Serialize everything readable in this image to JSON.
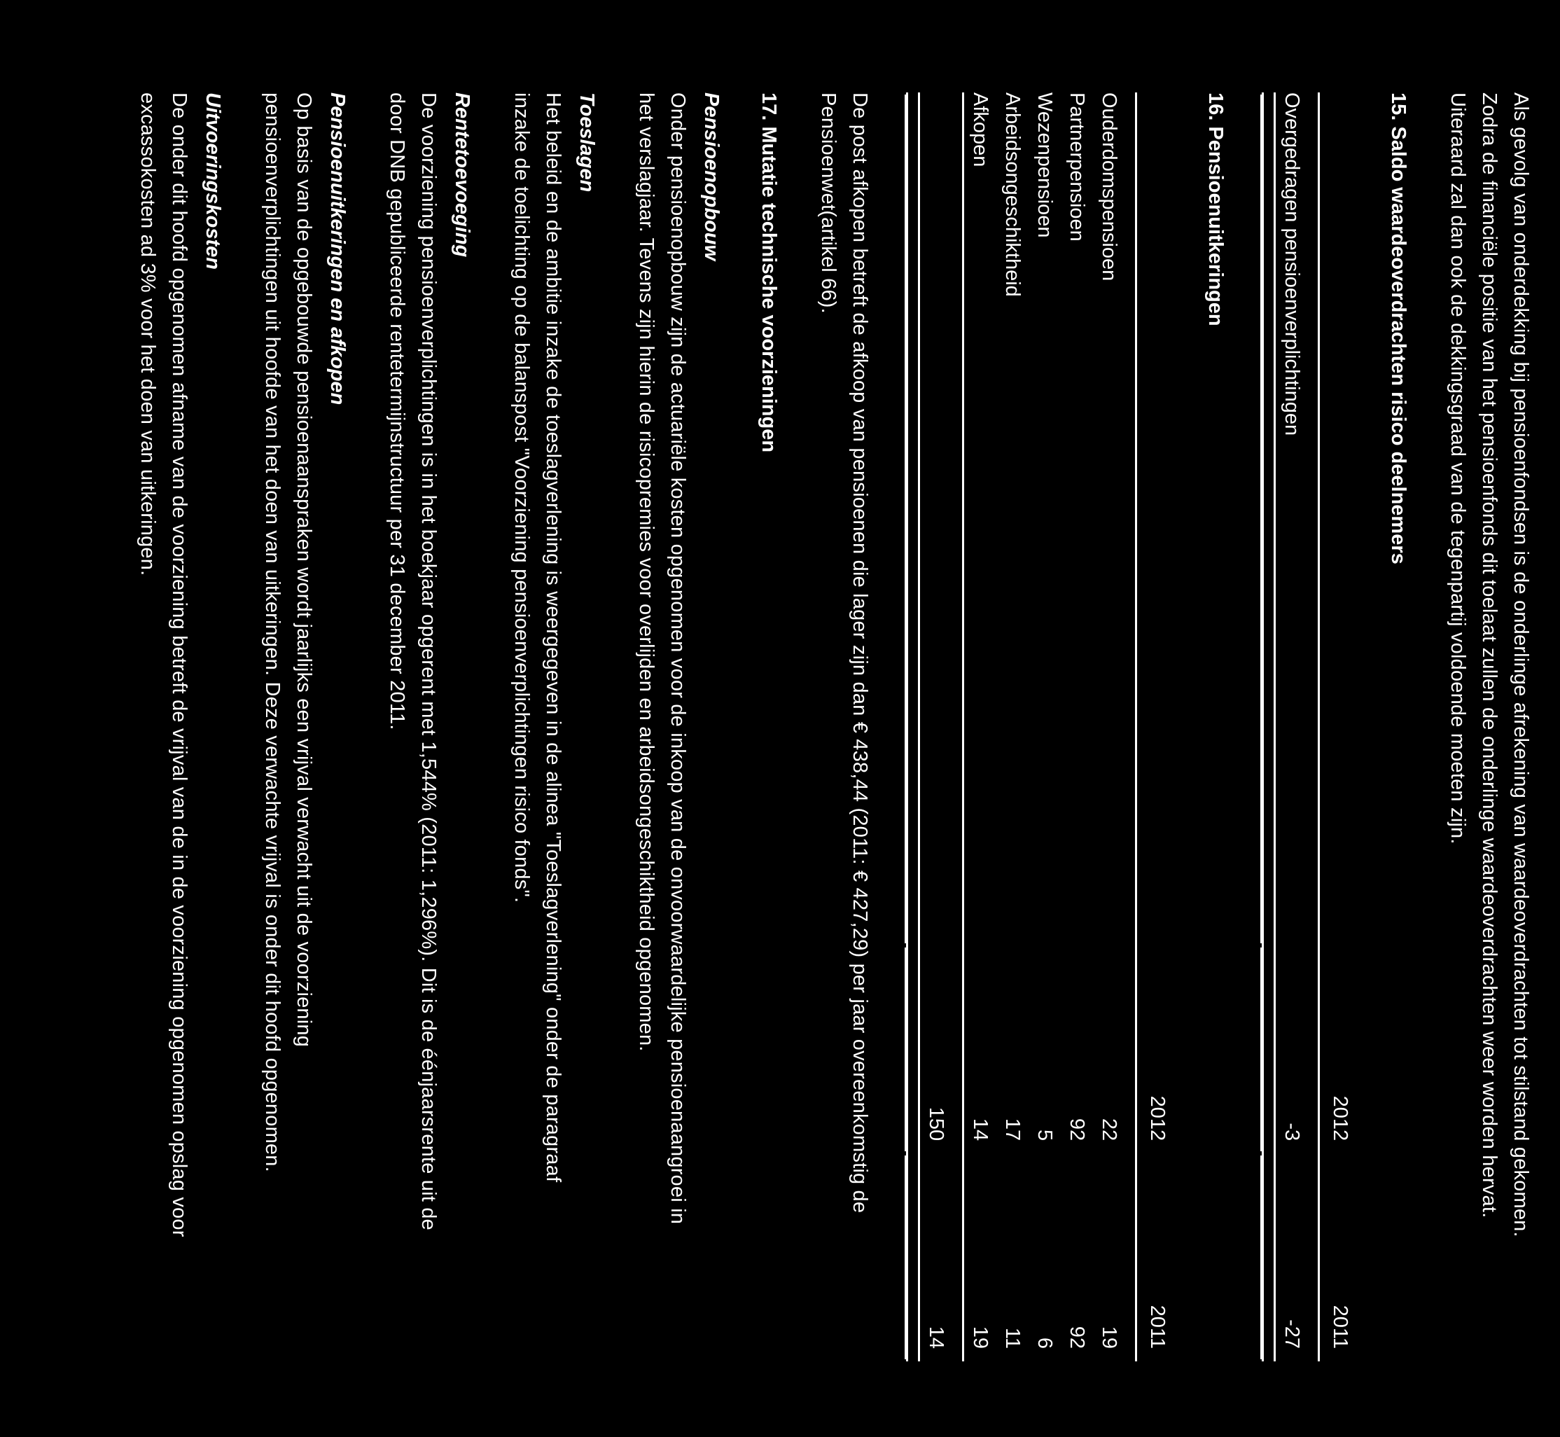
{
  "document": {
    "language": "nl",
    "background_color": "#000000",
    "text_color": "#ffffff",
    "rotation_degrees": 90,
    "inverted": true
  },
  "blocks": {
    "intro_paragraph": "Als gevolg van onderdekking bij pensioenfondsen is de onderlinge afrekening van waardeoverdrachten tot stilstand gekomen. Zodra de financiële positie van het pensioenfonds dit toelaat zullen de onderlinge waardeoverdrachten weer worden hervat. Uiteraard zal dan ook de dekkingsgraad van de tegenpartij voldoende moeten zijn.",
    "section_15_heading": "15. Saldo waardeoverdrachten risico deelnemers",
    "section_16_heading": "16. Pensioenuitkeringen",
    "afkopen_note": "De post afkopen betreft de afkoop van pensioenen die lager zijn dan € 438,44 (2011: € 427,29) per jaar overeenkomstig de Pensioenwet(artikel 66).",
    "section_17_heading": "17. Mutatie technische voorzieningen",
    "pensioenopbouw_heading": "Pensioenopbouw",
    "pensioenopbouw_body": "Onder pensioenopbouw zijn de actuariële kosten opgenomen voor de inkoop van de onvoorwaardelijke pensioenaangroei in het verslagjaar. Tevens zijn hierin de risicopremies voor overlijden en arbeidsongeschiktheid opgenomen.",
    "toeslagen_heading": "Toeslagen",
    "toeslagen_body": "Het beleid en de ambitie inzake de toeslagverlening is weergegeven in de alinea \"Toeslagverlening\" onder de paragraaf inzake de toelichting op de balanspost \"Voorziening pensioenverplichtingen risico fonds\".",
    "rentetoevoeging_heading": "Rentetoevoeging",
    "rentetoevoeging_body": "De voorziening pensioenverplichtingen is in het boekjaar opgerent met 1,544% (2011: 1,296%). Dit is de éénjaarsrente uit de door DNB gepubliceerde rentetermijnstructuur per 31 december 2011.",
    "pensioenuitkeringen_heading": "Pensioenuitkeringen en afkopen",
    "pensioenuitkeringen_body": "Op basis van de opgebouwde pensioenaanspraken wordt jaarlijks een vrijval verwacht uit de voorziening pensioenverplichtingen uit hoofde van het doen van uitkeringen. Deze verwachte vrijval is onder dit hoofd opgenomen.",
    "uitvoeringskosten_heading": "Uitvoeringskosten",
    "uitvoeringskosten_body": "De onder dit hoofd opgenomen afname van de voorziening betreft de vrijval van de in de voorziening opgenomen opslag voor excassokosten ad 3% voor het doen van uitkeringen."
  },
  "table_15": {
    "columns": [
      "",
      "2012",
      "2011"
    ],
    "rows": [
      {
        "label": "Overgedragen pensioenverplichtingen",
        "y2012": "-3",
        "y2011": "-27"
      }
    ]
  },
  "table_16": {
    "columns": [
      "",
      "2012",
      "2011"
    ],
    "rows": [
      {
        "label": "Ouderdomspensioen",
        "y2012": "22",
        "y2011": "19"
      },
      {
        "label": "Partnerpensioen",
        "y2012": "92",
        "y2011": "92"
      },
      {
        "label": "Wezenpensioen",
        "y2012": "5",
        "y2011": "6"
      },
      {
        "label": "Arbeidsongeschiktheid",
        "y2012": "17",
        "y2011": "11"
      },
      {
        "label": "Afkopen",
        "y2012": "14",
        "y2011": "19"
      }
    ],
    "total": {
      "label": "",
      "y2012": "150",
      "y2011": "14"
    }
  }
}
